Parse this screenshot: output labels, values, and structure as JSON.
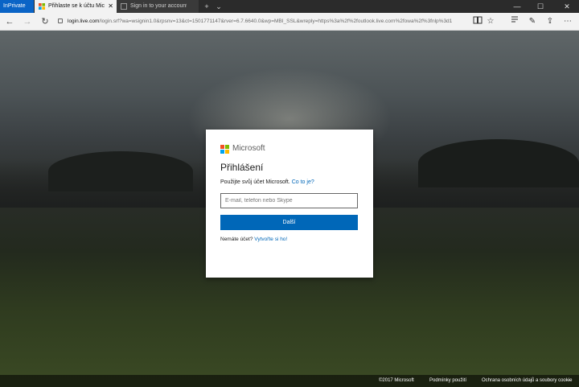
{
  "browser": {
    "inprivate_label": "InPrivate",
    "tabs": [
      {
        "label": "Přihlaste se k účtu Micro",
        "close": "✕",
        "active": true
      },
      {
        "label": "Sign in to your account",
        "active": false
      }
    ],
    "new_tab": "+",
    "tab_list": "⌄",
    "window_controls": {
      "minimize": "—",
      "maximize": "☐",
      "close": "✕"
    },
    "nav": {
      "back": "←",
      "forward": "→",
      "refresh": "↻"
    },
    "url_host": "login.live.com",
    "url_rest": "/login.srf?wa=wsignin1.0&rpsnv=13&ct=1501771147&rver=6.7.6640.0&wp=MBI_SSL&wreply=https%3a%2f%2foutlook.live.com%2fowa%2f%3fnlp%3d1",
    "toolbar_icons": [
      "reading-view-icon",
      "favorite-star-icon",
      "favorites-hub-icon",
      "web-note-icon",
      "share-icon",
      "more-icon"
    ]
  },
  "colors": {
    "accent": "#0067b8",
    "inprivate": "#0a64c6",
    "ms_red": "#f25022",
    "ms_green": "#7fba00",
    "ms_blue": "#00a4ef",
    "ms_yellow": "#ffb900"
  },
  "login": {
    "brand": "Microsoft",
    "heading": "Přihlášení",
    "subtext": "Použijte svůj účet Microsoft.",
    "help_link": "Co to je?",
    "email_placeholder": "E-mail, telefon nebo Skype",
    "email_value": "",
    "next_button": "Další",
    "no_account": "Nemáte účet?",
    "create_link": "Vytvořte si ho!"
  },
  "footer": {
    "copyright": "©2017 Microsoft",
    "terms": "Podmínky použití",
    "privacy": "Ochrana osobních údajů a soubory cookie",
    "more": "···"
  }
}
